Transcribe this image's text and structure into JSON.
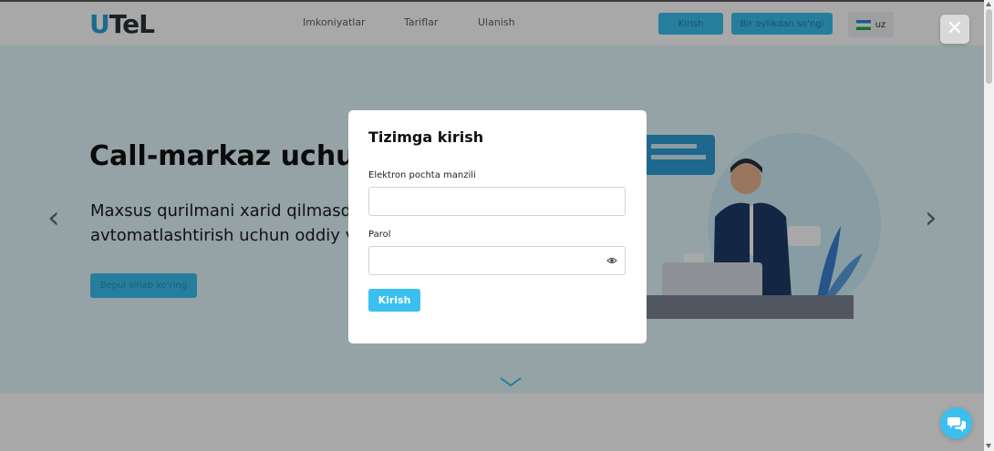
{
  "header": {
    "logo_first": "U",
    "logo_rest": "TeL",
    "nav": [
      "Imkoniyatlar",
      "Tariflar",
      "Ulanish"
    ],
    "login_button": "Kirish",
    "free_trial_button": "Bir oylikdan so'ngi",
    "language": "uz"
  },
  "hero": {
    "title": "Call-markaz uchun o",
    "subtitle_line1": "Maxsus qurilmani xarid qilmasdan,",
    "subtitle_line2": "avtomatlashtirish uchun oddiy va q",
    "cta_button": "Bepul sinab ko'ring",
    "prev_arrow": "‹",
    "next_arrow": "›"
  },
  "modal": {
    "title": "Tizimga kirish",
    "email_label": "Elektron pochta manzili",
    "email_value": "",
    "password_label": "Parol",
    "password_value": "",
    "submit_button": "Kirish"
  },
  "close_button": "✕",
  "colors": {
    "accent": "#3bbfef",
    "hero_bg": "#e2f7fc",
    "overlay": "rgba(0,0,0,0.34)"
  },
  "icons": {
    "close": "close-icon",
    "eye": "eye-icon",
    "chat": "chat-icon",
    "flag": "flag-uz-icon"
  }
}
